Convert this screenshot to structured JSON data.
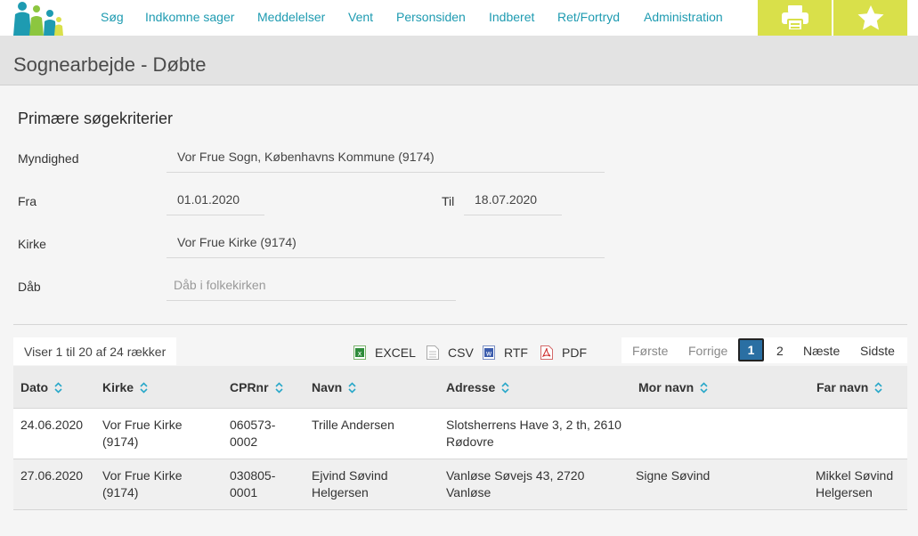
{
  "nav": {
    "items": [
      "Søg",
      "Indkomne sager",
      "Meddelelser",
      "Vent",
      "Personsiden",
      "Indberet",
      "Ret/Fortryd",
      "Administration"
    ]
  },
  "toolbar": {
    "print_icon": "printer-icon",
    "favorite_icon": "star-icon"
  },
  "page": {
    "title": "Sognearbejde - Døbte"
  },
  "criteria": {
    "section_title": "Primære søgekriterier",
    "myndighed_label": "Myndighed",
    "myndighed_value": "Vor Frue Sogn, Københavns Kommune (9174)",
    "fra_label": "Fra",
    "fra_value": "01.01.2020",
    "til_label": "Til",
    "til_value": "18.07.2020",
    "kirke_label": "Kirke",
    "kirke_value": "Vor Frue Kirke (9174)",
    "daab_label": "Dåb",
    "daab_placeholder": "Dåb i folkekirken"
  },
  "table_controls": {
    "row_count": "Viser 1 til 20 af 24 rækker",
    "exports": [
      "EXCEL",
      "CSV",
      "RTF",
      "PDF"
    ],
    "pager": {
      "first": "Første",
      "previous": "Forrige",
      "current": "1",
      "page2": "2",
      "next": "Næste",
      "last": "Sidste"
    }
  },
  "table": {
    "headers": [
      "Dato",
      "Kirke",
      "CPRnr",
      "Navn",
      "Adresse",
      "Mor navn",
      "Far navn"
    ],
    "rows": [
      {
        "dato": "24.06.2020",
        "kirke": "Vor Frue Kirke (9174)",
        "cpr": "060573-0002",
        "navn": "Trille Andersen",
        "adresse": "Slotsherrens Have 3, 2 th, 2610 Rødovre",
        "mor": "",
        "far": ""
      },
      {
        "dato": "27.06.2020",
        "kirke": "Vor Frue Kirke (9174)",
        "cpr": "030805-0001",
        "navn": "Ejvind Søvind Helgersen",
        "adresse": "Vanløse Søvejs 43, 2720 Vanløse",
        "mor": "Signe Søvind",
        "far": "Mikkel Søvind Helgersen"
      }
    ]
  },
  "colors": {
    "nav_text": "#1e9bb1",
    "tool_button": "#d9e04a",
    "page_header_bg": "#e3e3e3",
    "active_page": "#2a6fa3"
  }
}
